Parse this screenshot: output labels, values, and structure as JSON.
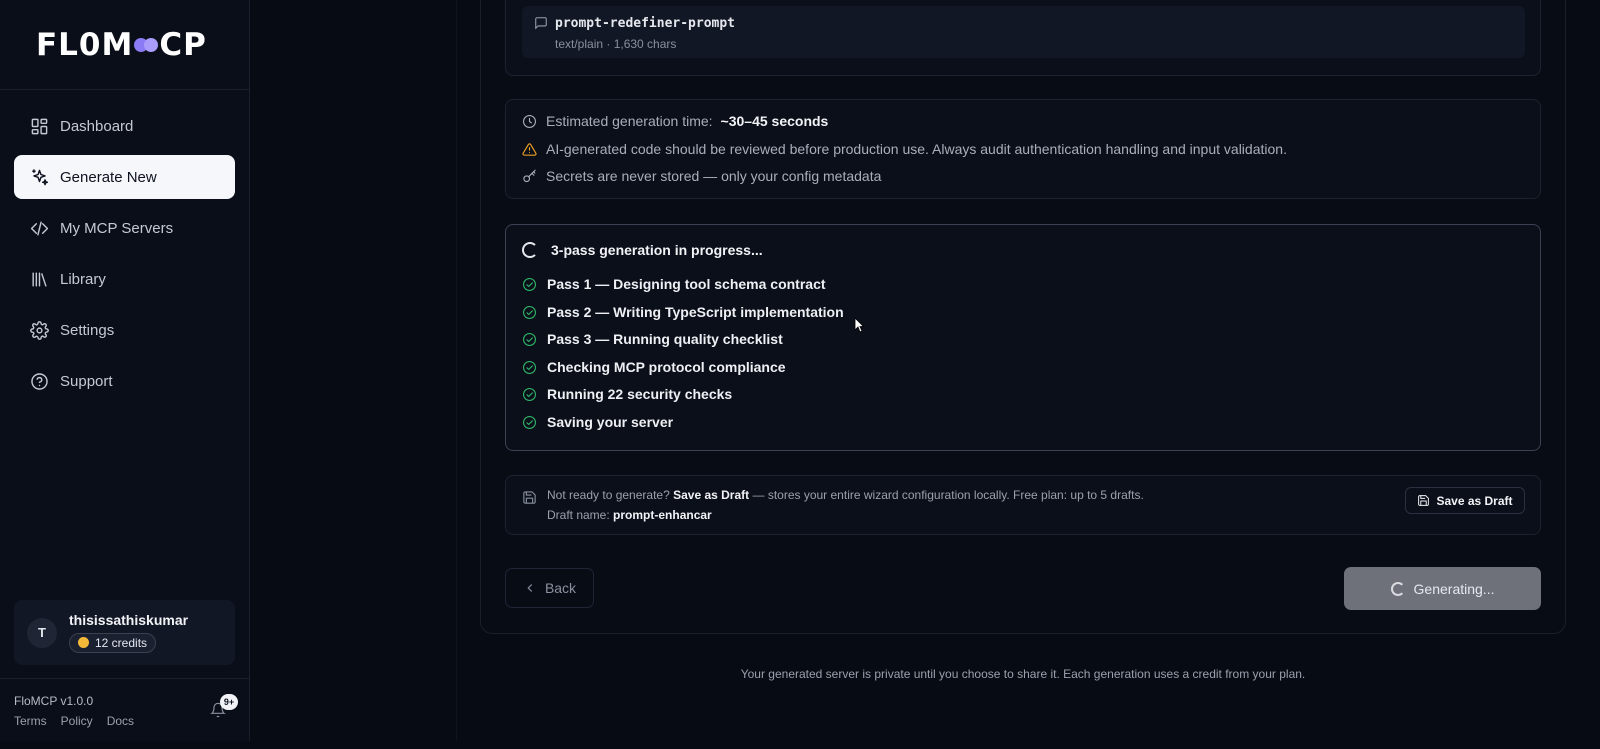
{
  "app": {
    "logo_text_a": "FL0M",
    "logo_text_b": "CP",
    "version": "FloMCP v1.0.0"
  },
  "sidebar": {
    "items": [
      {
        "label": "Dashboard",
        "icon": "grid-icon"
      },
      {
        "label": "Generate New",
        "icon": "sparkles-icon",
        "active": true
      },
      {
        "label": "My MCP Servers",
        "icon": "code-icon"
      },
      {
        "label": "Library",
        "icon": "library-icon"
      },
      {
        "label": "Settings",
        "icon": "gear-icon"
      },
      {
        "label": "Support",
        "icon": "help-circle-icon"
      }
    ],
    "user": {
      "initial": "T",
      "name": "thisissathiskumar",
      "credits": "12 credits"
    },
    "footer_links": [
      "Terms",
      "Policy",
      "Docs"
    ],
    "notification_badge": "9+"
  },
  "resource": {
    "name": "prompt-redefiner-prompt",
    "meta": "text/plain · 1,630 chars"
  },
  "info": {
    "estimate_label": "Estimated generation time:",
    "estimate_value": "~30–45 seconds",
    "warning": "AI-generated code should be reviewed before production use. Always audit authentication handling and input validation.",
    "secrets": "Secrets are never stored — only your config metadata"
  },
  "progress": {
    "title": "3-pass generation in progress...",
    "steps": [
      "Pass 1 — Designing tool schema contract",
      "Pass 2 — Writing TypeScript implementation",
      "Pass 3 — Running quality checklist",
      "Checking MCP protocol compliance",
      "Running 22 security checks",
      "Saving your server"
    ]
  },
  "draft": {
    "prefix": "Not ready to generate?",
    "bold": "Save as Draft",
    "suffix": "— stores your entire wizard configuration locally. Free plan: up to 5 drafts.",
    "name_label": "Draft name:",
    "name_value": "prompt-enhancar",
    "button_label": "Save as Draft"
  },
  "actions": {
    "back_label": "Back",
    "generating_label": "Generating..."
  },
  "footer_note": "Your generated server is private until you choose to share it. Each generation uses a credit from your plan.",
  "colors": {
    "background": "#070b14",
    "accent": "#8b7cf6",
    "success": "#2fb56a",
    "warning": "#f5a524"
  }
}
